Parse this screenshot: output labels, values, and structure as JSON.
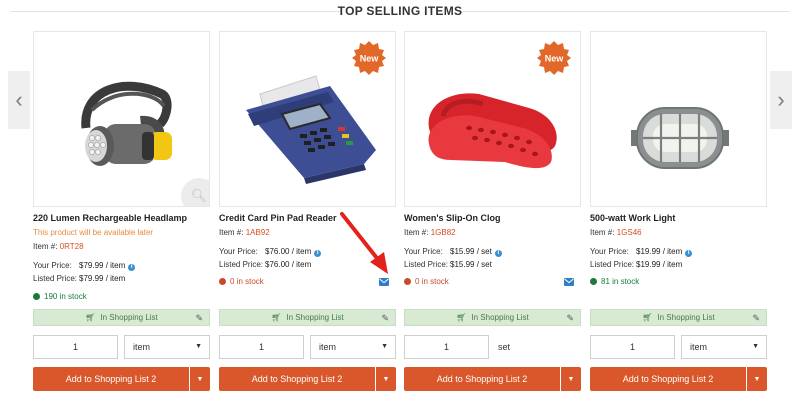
{
  "section": {
    "title": "TOP SELLING ITEMS"
  },
  "nav": {
    "prev_glyph": "‹",
    "next_glyph": "›"
  },
  "labels": {
    "your_price": "Your Price:",
    "listed_price": "Listed Price:",
    "in_list": "In Shopping List",
    "item_no": "Item #:"
  },
  "colors": {
    "accent": "#d9572a",
    "in_stock": "#1b7a39",
    "out_stock": "#c84a2a",
    "in_list_bg": "#d8ead3",
    "badge": "#e2682a",
    "unavailable": "#e98b39"
  },
  "products": [
    {
      "name": "220 Lumen Rechargeable Headlamp",
      "availability": "This product will be available later",
      "item_code": "0RT28",
      "your_price": "$79.99 / item",
      "listed_price": "$79.99 / item",
      "stock": "190 in stock",
      "stock_status": "in",
      "badge": "",
      "qty": "1",
      "unit": "item",
      "add_label": "Add to Shopping List 2",
      "image_icon": "headlamp-image"
    },
    {
      "name": "Credit Card Pin Pad Reader",
      "availability": "",
      "item_code": "1AB92",
      "your_price": "$76.00 / item",
      "listed_price": "$76.00 / item",
      "stock": "0 in stock",
      "stock_status": "out",
      "badge": "New",
      "qty": "1",
      "unit": "item",
      "add_label": "Add to Shopping List 2",
      "image_icon": "card-reader-image"
    },
    {
      "name": "Women's Slip-On Clog",
      "availability": "",
      "item_code": "1GB82",
      "your_price": "$15.99 / set",
      "listed_price": "$15.99 / set",
      "stock": "0 in stock",
      "stock_status": "out",
      "badge": "New",
      "qty": "1",
      "unit": "set",
      "add_label": "Add to Shopping List 2",
      "image_icon": "clogs-image"
    },
    {
      "name": "500-watt Work Light",
      "availability": "",
      "item_code": "1GS46",
      "your_price": "$19.99 / item",
      "listed_price": "$19.99 / item",
      "stock": "81 in stock",
      "stock_status": "in",
      "badge": "",
      "qty": "1",
      "unit": "item",
      "add_label": "Add to Shopping List 2",
      "image_icon": "work-light-image"
    }
  ]
}
